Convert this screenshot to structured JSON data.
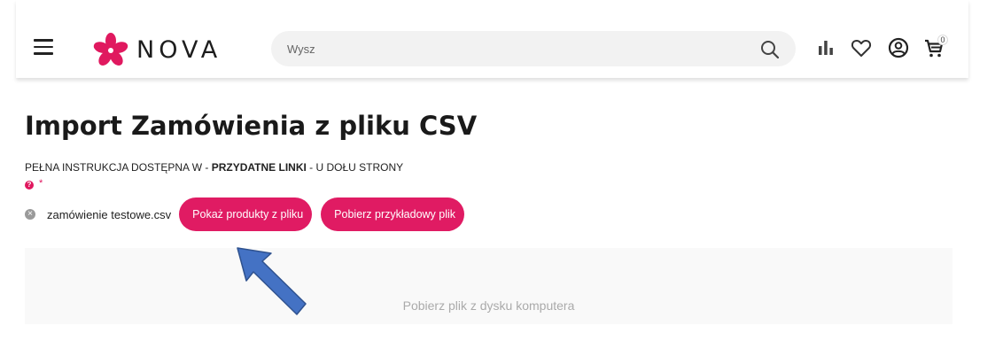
{
  "header": {
    "logo_text": "NOVA",
    "search_placeholder": "Wysz",
    "cart_count": "0",
    "icons": [
      "menu-icon",
      "flower-logo-icon",
      "search-icon",
      "compare-chart-icon",
      "heart-icon",
      "user-icon",
      "cart-icon"
    ]
  },
  "main": {
    "title": "Import Zamówienia z pliku CSV",
    "instructions": {
      "prefix": "PEŁNA INSTRUKCJA DOSTĘPNA W - ",
      "link": "PRZYDATNE LINKI",
      "suffix": " - U DOŁU STRONY"
    },
    "help_icon_glyph": "?",
    "required_mark": "*",
    "file": {
      "name": "zamówienie testowe.csv",
      "remove_glyph": "×"
    },
    "buttons": {
      "show_products": "Pokaż produkty z pliku",
      "download_sample": "Pobierz przykładowy plik"
    },
    "dropzone_text": "Pobierz plik z dysku komputera"
  },
  "colors": {
    "accent": "#e01b63",
    "arrow": "#4472c4"
  }
}
